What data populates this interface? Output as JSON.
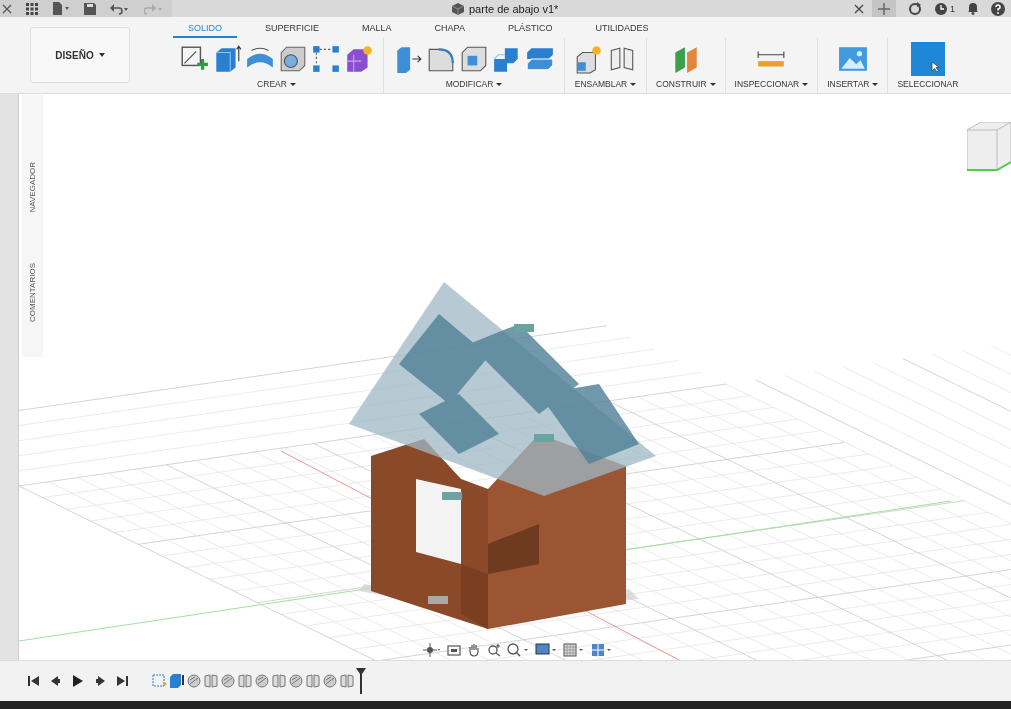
{
  "window": {
    "title": "parte de abajo v1*",
    "notification_count": "1"
  },
  "workspace": {
    "label": "DISEÑO",
    "dropdown": true
  },
  "tabs": [
    {
      "label": "SOLIDO",
      "selected": true
    },
    {
      "label": "SUPERFICIE",
      "selected": false
    },
    {
      "label": "MALLA",
      "selected": false
    },
    {
      "label": "CHAPA",
      "selected": false
    },
    {
      "label": "PLÁSTICO",
      "selected": false
    },
    {
      "label": "UTILIDADES",
      "selected": false
    }
  ],
  "tool_groups": [
    {
      "label": "CREAR",
      "dropdown": true,
      "tools": [
        {
          "kind": "sketch"
        },
        {
          "kind": "extrude"
        },
        {
          "kind": "revolve"
        },
        {
          "kind": "hole"
        },
        {
          "kind": "pattern"
        },
        {
          "kind": "form"
        }
      ]
    },
    {
      "label": "MODIFICAR",
      "dropdown": true,
      "tools": [
        {
          "kind": "presspull"
        },
        {
          "kind": "fillet"
        },
        {
          "kind": "shell"
        },
        {
          "kind": "combine"
        },
        {
          "kind": "offset"
        }
      ]
    },
    {
      "label": "ENSAMBLAR",
      "dropdown": true,
      "tools": [
        {
          "kind": "component"
        },
        {
          "kind": "joint"
        }
      ]
    },
    {
      "label": "CONSTRUIR",
      "dropdown": true,
      "tools": [
        {
          "kind": "plane"
        }
      ]
    },
    {
      "label": "INSPECCIONAR",
      "dropdown": true,
      "tools": [
        {
          "kind": "measure"
        }
      ]
    },
    {
      "label": "INSERTAR",
      "dropdown": true,
      "tools": [
        {
          "kind": "image"
        }
      ]
    },
    {
      "label": "SELECCIONAR",
      "dropdown": false,
      "tools": [
        {
          "kind": "select"
        }
      ]
    }
  ],
  "side_panel": [
    "NAVEGADOR",
    "COMENTARIOS"
  ],
  "timeline": {
    "features": [
      {
        "kind": "sketch"
      },
      {
        "kind": "extrude"
      },
      {
        "kind": "combine"
      },
      {
        "kind": "joint"
      },
      {
        "kind": "combine"
      },
      {
        "kind": "joint"
      },
      {
        "kind": "combine"
      },
      {
        "kind": "joint"
      },
      {
        "kind": "combine"
      },
      {
        "kind": "joint"
      },
      {
        "kind": "combine"
      },
      {
        "kind": "joint"
      }
    ]
  }
}
